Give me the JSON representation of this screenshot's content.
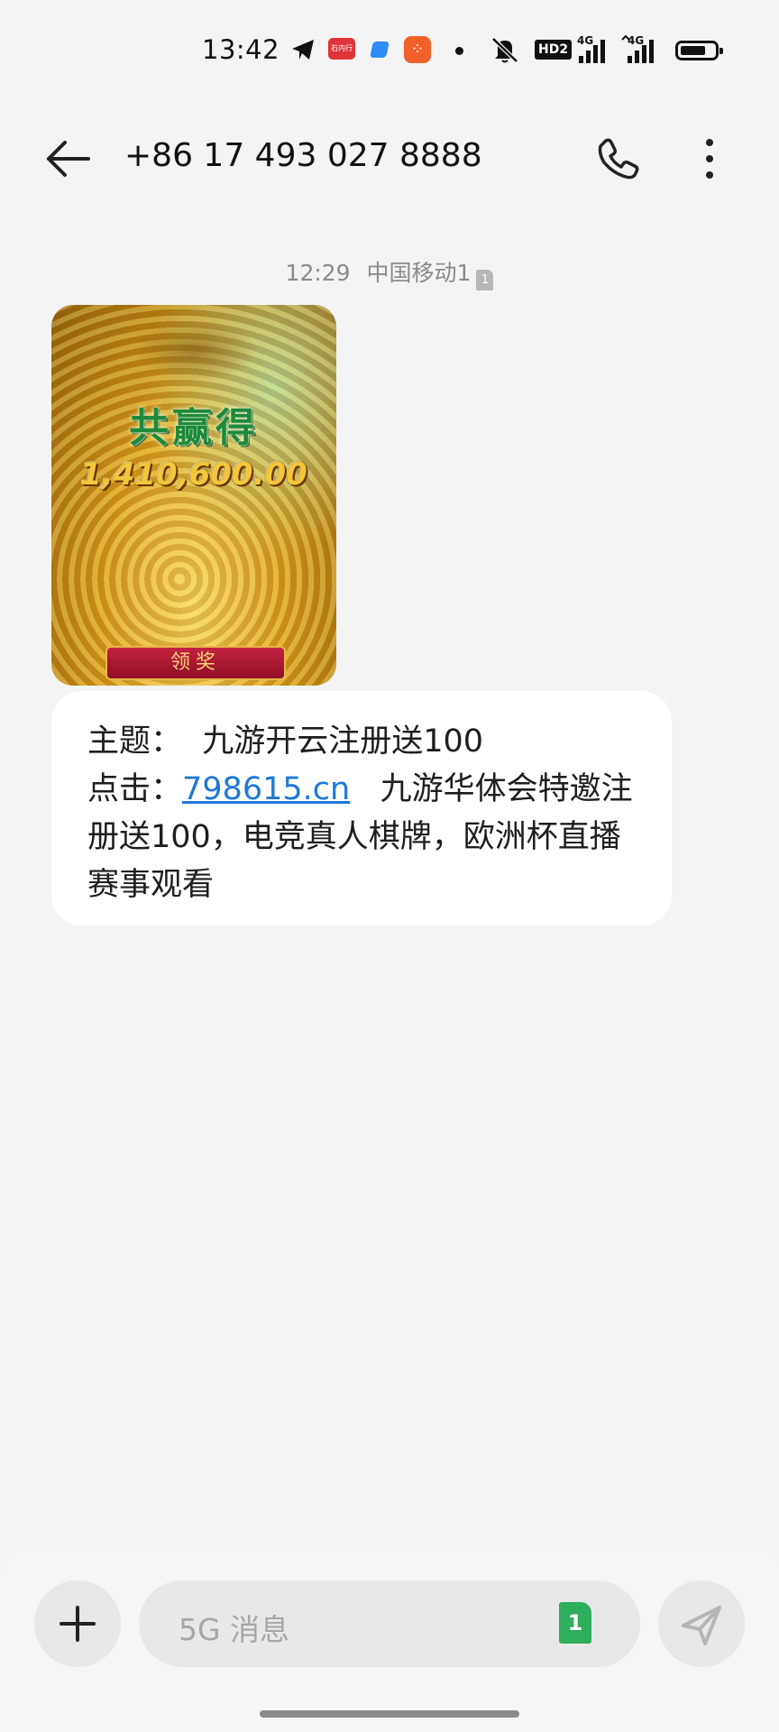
{
  "status_bar": {
    "time": "13:42",
    "notif_red_label": "石内行",
    "hd_label": "HD2",
    "signal_1_label": "4G",
    "signal_2_label": "4G",
    "battery_level": 0.75,
    "icons": [
      "telegram-icon",
      "app-notification-icon",
      "app-notification-icon",
      "app-notification-icon",
      "dot-icon",
      "mute-icon",
      "hd-icon",
      "signal-icon",
      "signal-icon",
      "battery-icon"
    ]
  },
  "header": {
    "title": "+86 17 493 027 8888",
    "icons": [
      "back-arrow-icon",
      "phone-icon",
      "more-vertical-icon"
    ]
  },
  "thread": {
    "timestamp": "12:29",
    "carrier": "中国移动1",
    "sim_number": "1"
  },
  "image_card": {
    "headline": "共赢得",
    "amount": "1,410,600.00",
    "cta": "领奖"
  },
  "message": {
    "line1": "主题：  九游开云注册送100",
    "prefix": "点击：",
    "link": "798615.cn",
    "rest": "   九游华体会特邀注册送100，电竞真人棋牌，欧洲杯直播赛事观看"
  },
  "compose": {
    "placeholder": "5G 消息",
    "sim_badge": "1",
    "icons": [
      "plus-icon",
      "send-icon"
    ]
  },
  "colors": {
    "background": "#f4f4f4",
    "bubble": "#ffffff",
    "link": "#1d78d8",
    "sim_badge": "#2fae5c"
  }
}
